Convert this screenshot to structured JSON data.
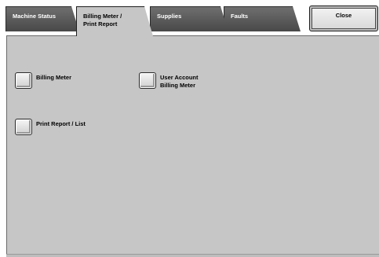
{
  "tabs": {
    "machine_status": "Machine Status",
    "billing_meter": "Billing Meter /\nPrint Report",
    "supplies": "Supplies",
    "faults": "Faults"
  },
  "close_label": "Close",
  "options": {
    "billing_meter": "Billing Meter",
    "user_account_billing_meter": "User Account\nBilling Meter",
    "print_report_list": "Print Report / List"
  }
}
